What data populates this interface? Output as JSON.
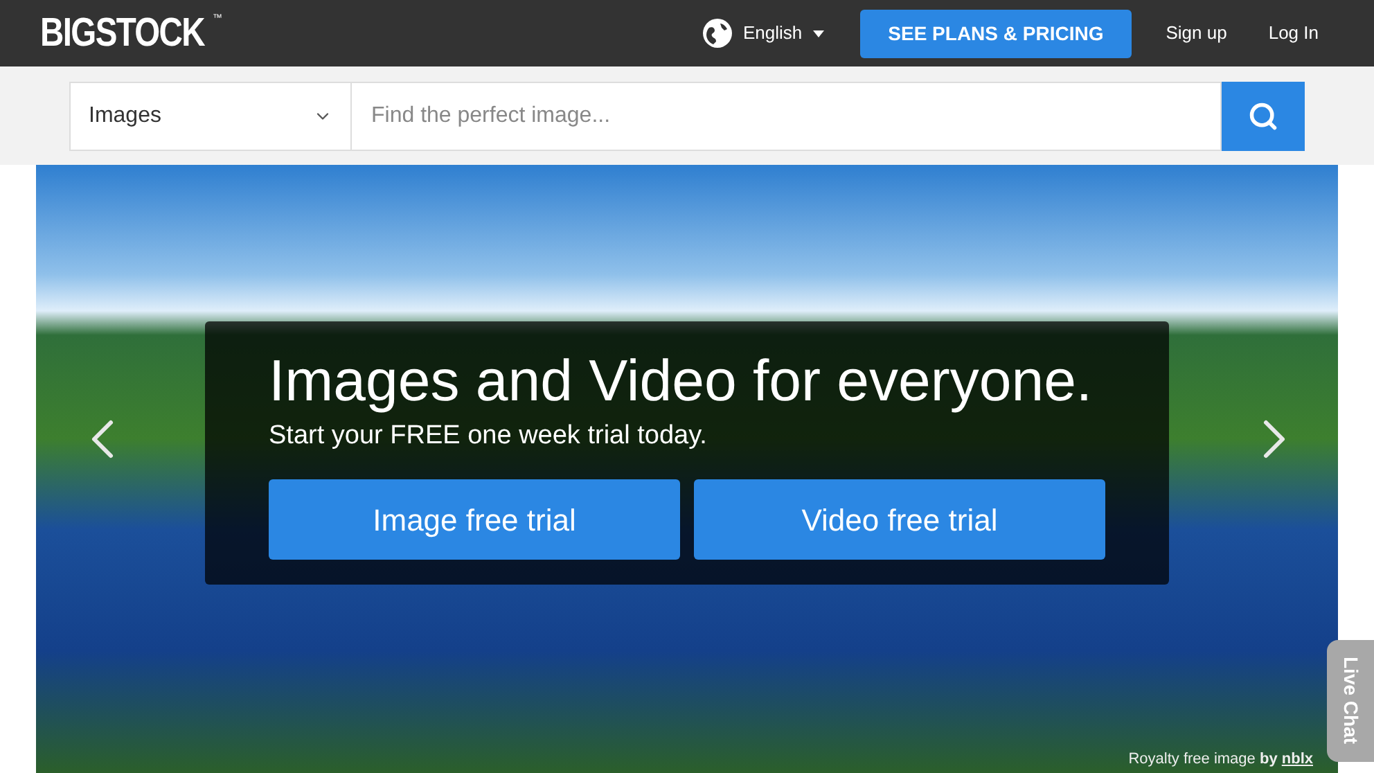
{
  "header": {
    "logo": "BIGSTOCK",
    "logo_mark": "™",
    "language": "English",
    "cta": "SEE PLANS & PRICING",
    "links": [
      "Sign up",
      "Log In"
    ]
  },
  "search": {
    "category": "Images",
    "placeholder": "Find the perfect image..."
  },
  "hero": {
    "title": "Images and Video for everyone.",
    "subtitle": "Start your FREE one week trial today.",
    "buttons": [
      "Image free trial",
      "Video free trial"
    ],
    "credit": "Royalty free image **by**",
    "credit_link": "nblx"
  },
  "live_chat": "Live Chat"
}
